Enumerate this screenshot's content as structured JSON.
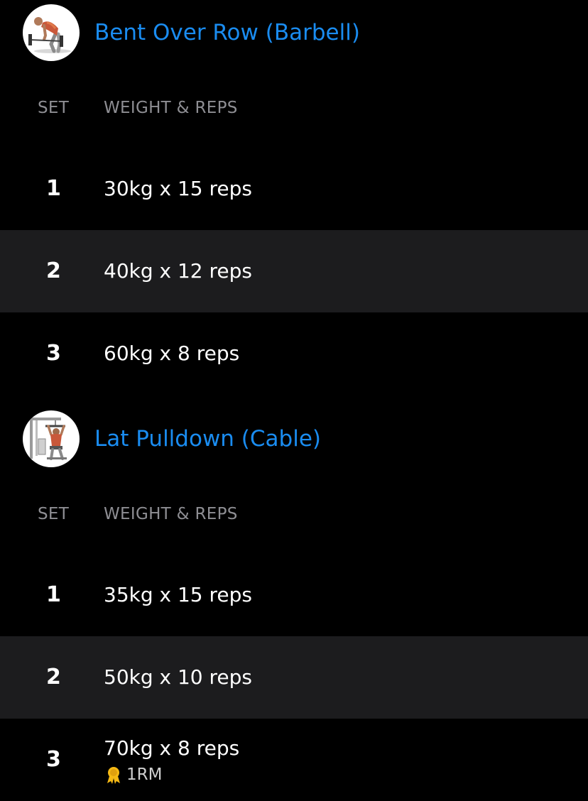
{
  "exercises": [
    {
      "title": "Bent Over Row (Barbell)",
      "thumb_icon": "barbell-row-figure",
      "columns": {
        "set": "SET",
        "weight_reps": "WEIGHT & REPS"
      },
      "sets": [
        {
          "num": "1",
          "text": "30kg x 15 reps"
        },
        {
          "num": "2",
          "text": "40kg x 12 reps"
        },
        {
          "num": "3",
          "text": "60kg x 8 reps"
        }
      ]
    },
    {
      "title": "Lat Pulldown (Cable)",
      "thumb_icon": "lat-pulldown-figure",
      "columns": {
        "set": "SET",
        "weight_reps": "WEIGHT & REPS"
      },
      "sets": [
        {
          "num": "1",
          "text": "35kg x 15 reps"
        },
        {
          "num": "2",
          "text": "50kg x 10 reps"
        },
        {
          "num": "3",
          "text": "70kg x 8 reps",
          "record": "1RM",
          "record_icon": "medal-icon"
        }
      ]
    }
  ],
  "colors": {
    "background": "#000000",
    "alt_row": "#1c1c1e",
    "title_blue": "#1a8cf0",
    "column_gray": "#8e8e93",
    "medal_gold": "#f5b914"
  }
}
